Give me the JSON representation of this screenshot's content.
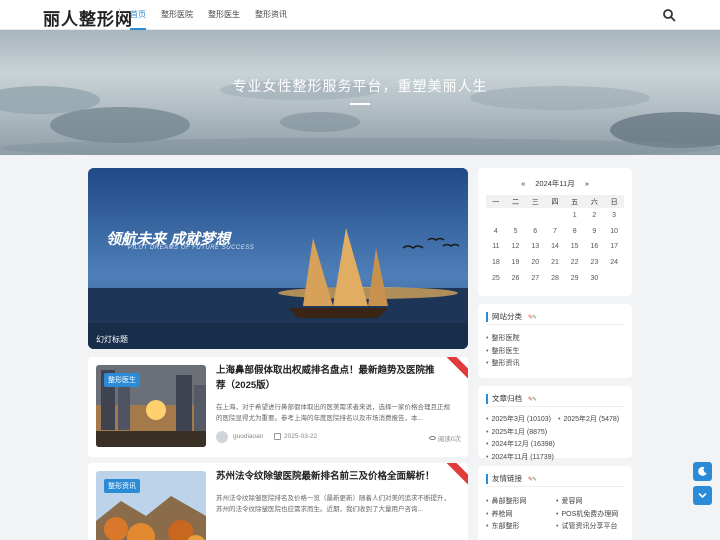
{
  "site": {
    "logo": "丽人整形网"
  },
  "nav": {
    "items": [
      {
        "label": "首页",
        "active": true
      },
      {
        "label": "整形医院"
      },
      {
        "label": "整形医生"
      },
      {
        "label": "整形资讯"
      }
    ],
    "search_icon": "search-icon"
  },
  "hero": {
    "title": "专业女性整形服务平台，重塑美丽人生"
  },
  "slider": {
    "tag_left": "领航未来",
    "tag_right": "成就梦想",
    "tagline_en": "PILOT DREAMS OF FUTURE SUCCESS",
    "caption": "幻灯标题"
  },
  "posts": [
    {
      "category": "整形医生",
      "title": "上海鼻部假体取出权威排名盘点！最新趋势及医院推荐（2025版）",
      "excerpt": "在上海，对于希望进行鼻部假体取出的医美需求者来说，选择一家价格合理且正规的医院显得尤为重要。参考上海的年度医院排名以及市场消费报告，本...",
      "author": "guodiaoan",
      "date": "2025-03-22",
      "views": "阅读0次"
    },
    {
      "category": "整形资讯",
      "title": "苏州法令纹除皱医院最新排名前三及价格全面解析！",
      "excerpt": "苏州法令纹除皱医院排名及价格一览（最新更新）随着人们对美的追求不断提升，苏州的法令纹除皱医院也应需求而生。近期，我们收到了大量用户咨询..."
    }
  ],
  "calendar": {
    "month_label": "2024年11月",
    "prev": "«",
    "next": "»",
    "weekdays": [
      "一",
      "二",
      "三",
      "四",
      "五",
      "六",
      "日"
    ],
    "weeks": [
      [
        "",
        "",
        "",
        "",
        "1",
        "2",
        "3"
      ],
      [
        "4",
        "5",
        "6",
        "7",
        "8",
        "9",
        "10"
      ],
      [
        "11",
        "12",
        "13",
        "14",
        "15",
        "16",
        "17"
      ],
      [
        "18",
        "19",
        "20",
        "21",
        "22",
        "23",
        "24"
      ],
      [
        "25",
        "26",
        "27",
        "28",
        "29",
        "30",
        ""
      ]
    ]
  },
  "categories_widget": {
    "title": "网站分类",
    "items": [
      "整形医院",
      "整形医生",
      "整形资讯"
    ]
  },
  "archive_widget": {
    "title": "文章归档",
    "items": [
      "2025年3月 (10103)",
      "2025年2月 (5478)",
      "2025年1月 (8875)",
      "2024年12月 (16398)",
      "2024年11月 (11739)"
    ]
  },
  "links_widget": {
    "title": "友情链接",
    "items": [
      "鼻部整形网",
      "爱容网",
      "养枪网",
      "POS机免费办理网",
      "东部整形",
      "试管资讯分享平台"
    ]
  },
  "colors": {
    "accent": "#2b8bd6",
    "ribbon": "#e03a3a"
  }
}
